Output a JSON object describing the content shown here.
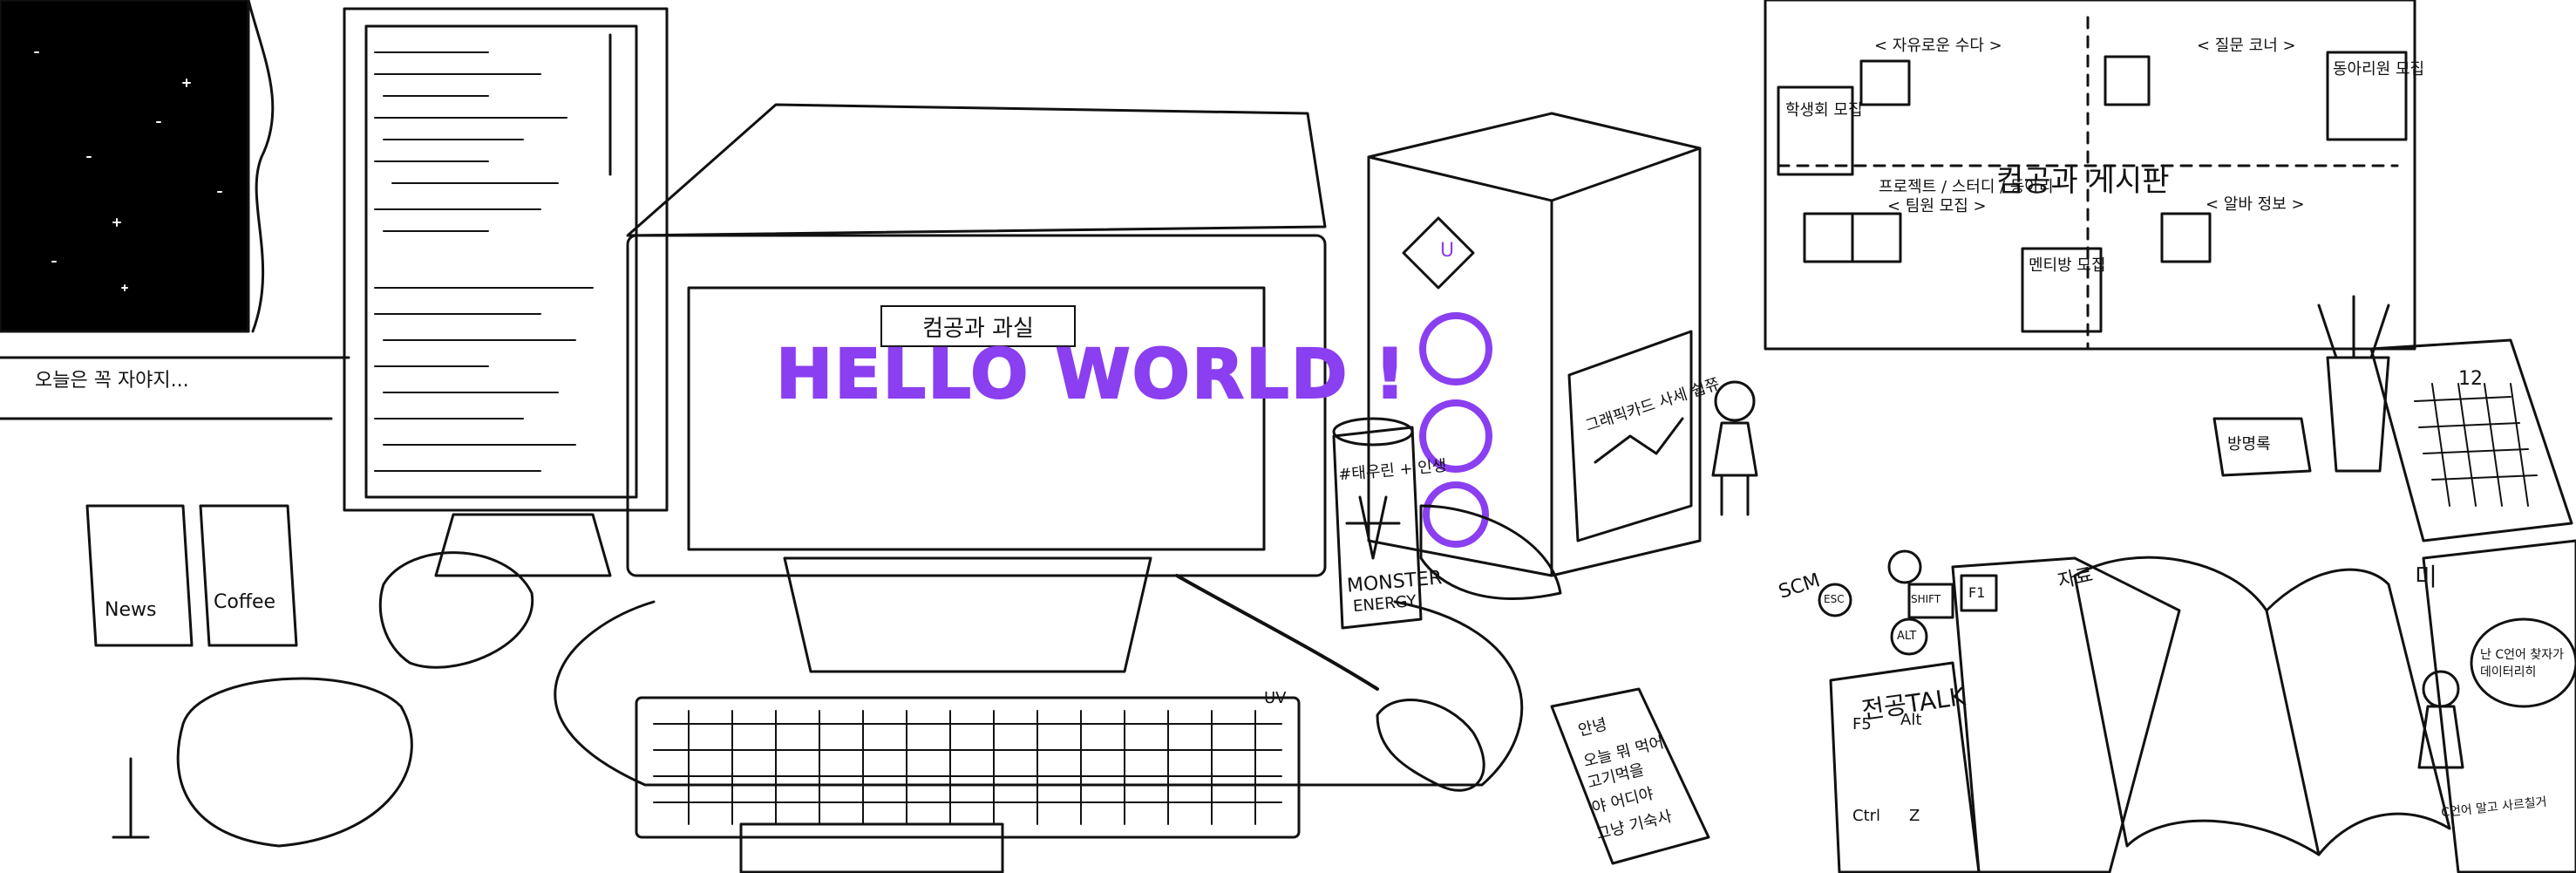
{
  "colors": {
    "accent": "#8a3ff0",
    "ink": "#111111",
    "night": "#000000",
    "paper": "#ffffff"
  },
  "screen": {
    "label": "컴공과 과실",
    "headline": "HELLO WORLD !"
  },
  "window": {
    "caption": "오늘은 꼭 자야지..."
  },
  "stalls": {
    "news": "News",
    "coffee": "Coffee"
  },
  "board": {
    "title": "컴공과 게시판",
    "sections": [
      "< 자유로운 수다 >",
      "< 질문 코너 >",
      "< 알바 정보 >"
    ],
    "team_label_top": "프로젝트 / 스터디 / 동아리",
    "team_label": "< 팀원 모집 >",
    "notes": [
      "학생회 모집",
      "동아리원 모집",
      "멘티방 모집"
    ]
  },
  "monitor_brand": "UV",
  "tower_logo": "U",
  "poster_text": "그래픽카드 사세 쉽쮸",
  "can": {
    "brand": "MONSTER",
    "sub": "ENERGY",
    "note": "#태우린 + 인생"
  },
  "phone": {
    "lines": [
      "안녕",
      "오늘 뭐 먹어",
      "고기먹을",
      "야 어디야",
      "그냥 기숙사"
    ]
  },
  "keys": {
    "esc": "ESC",
    "shift": "SHIFT",
    "f1": "F1",
    "alt": "ALT"
  },
  "book_title": "전공TALK",
  "book_keys": [
    "F5",
    "Alt",
    "Ctrl",
    "Z"
  ],
  "guestbook": "방명록",
  "calendar_day": "12",
  "speech": "난 C언어 찾자가 데이터리히",
  "sign_text": "C언어 말고 사르칠거",
  "scroll_tabs": [
    "SCM",
    "자료",
    "미"
  ],
  "icons": [
    "headphones-icon",
    "earbuds-case-icon",
    "mouse-icon",
    "keyboard-icon",
    "pencil-cup-icon",
    "calendar-icon"
  ]
}
